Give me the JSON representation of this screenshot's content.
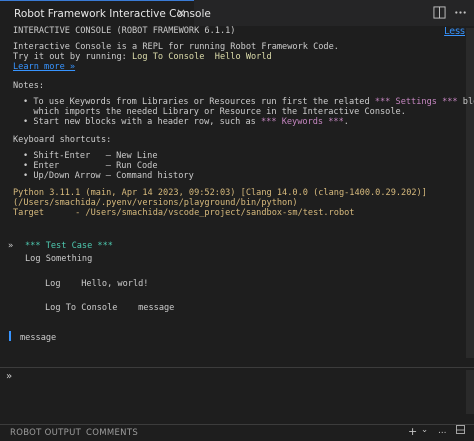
{
  "tab": {
    "title": "Robot Framework Interactive Console",
    "close_glyph": "×"
  },
  "toolbar": {
    "split_icon": "split-editor-icon",
    "more_icon": "more-actions-icon"
  },
  "header": {
    "banner": "INTERACTIVE CONSOLE (ROBOT FRAMEWORK 6.1.1)",
    "less_link": "Less"
  },
  "intro": {
    "line1": "Interactive Console is a REPL for running Robot Framework Code.",
    "line2_prefix": "Try it out by running: ",
    "line2_code": "Log To Console  Hello World",
    "learn_more": "Learn more »"
  },
  "notes": {
    "heading": "Notes:",
    "b1_pre": "• To use Keywords from Libraries or Resources run first the related ",
    "b1_kw": "*** Settings ***",
    "b1_post": " block",
    "b1_line2": "  which imports the needed Library or Resource in the Interactive Console.",
    "b2_pre": "• Start new blocks with a header row, such as ",
    "b2_kw": "*** Keywords ***",
    "b2_post": "."
  },
  "shortcuts": {
    "heading": "Keyboard shortcuts:",
    "items": [
      "• Shift-Enter   – New Line",
      "• Enter         – Run Code",
      "• Up/Down Arrow – Command history"
    ]
  },
  "env": {
    "python": "Python 3.11.1 (main, Apr 14 2023, 09:52:03) [Clang 14.0.0 (clang-1400.0.29.202)]",
    "path": "(/Users/smachida/.pyenv/versions/playground/bin/python)",
    "target": "Target      - /Users/smachida/vscode_project/sandbox-sm/test.robot"
  },
  "cell": {
    "marker": "»",
    "header": "*** Test Case ***",
    "test_name": "Log Something",
    "step1": "Log    Hello, world!",
    "step2": "Log To Console    message"
  },
  "output": {
    "text": "message"
  },
  "input": {
    "prompt": "»",
    "value": ""
  },
  "bottom_tabs": [
    "ROBOT OUTPUT",
    "COMMENTS"
  ],
  "bottom_actions": {
    "add": "+",
    "dropdown": "⌄",
    "more": "…"
  },
  "colors": {
    "accent": "#3794ff",
    "keyword": "#c586c0",
    "code": "#dcdcaa",
    "header": "#4ec9b0"
  }
}
